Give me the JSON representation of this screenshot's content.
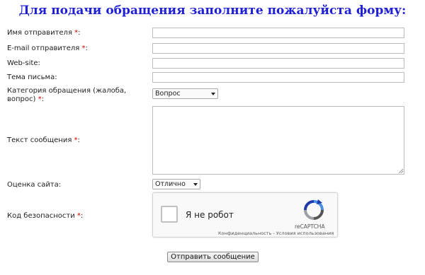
{
  "form": {
    "title": "Для подачи обращения заполните пожалуйста форму:",
    "required_mark": "*",
    "fields": {
      "name": {
        "label": "Имя отправителя",
        "value": ""
      },
      "email": {
        "label": "E-mail отправителя",
        "value": ""
      },
      "website": {
        "label": "Web-site:",
        "value": ""
      },
      "subject": {
        "label": "Тема письма:",
        "value": ""
      },
      "category": {
        "label_line1": "Категория обращения (жалоба,",
        "label_line2": "вопрос)",
        "selected": "Вопрос"
      },
      "message": {
        "label": "Текст сообщения",
        "value": ""
      },
      "rating": {
        "label": "Оценка сайта:",
        "selected": "Отлично"
      },
      "security": {
        "label": "Код безопасности"
      }
    },
    "captcha": {
      "checkbox_label": "Я не робот",
      "brand": "reCAPTCHA",
      "privacy": "Конфиденциальность",
      "separator": " - ",
      "terms": "Условия использования",
      "checked": false
    },
    "submit_label": "Отправить сообщение",
    "colors": {
      "title": "#1f1fd6",
      "required": "#d40000"
    }
  }
}
